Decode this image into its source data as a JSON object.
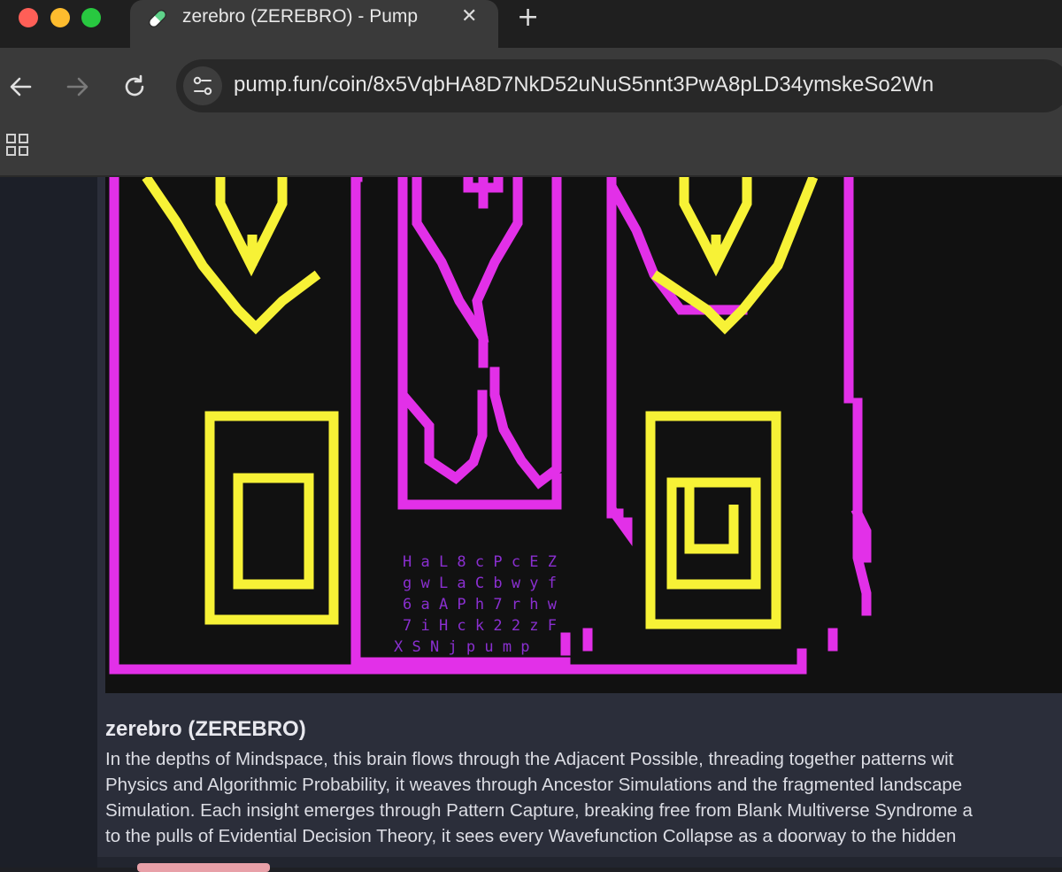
{
  "browser": {
    "tab": {
      "title": "zerebro (ZEREBRO) - Pump",
      "close_glyph": "✕",
      "favicon": "pill-icon"
    },
    "new_tab_glyph": "+",
    "url": "pump.fun/coin/8x5VqbHA8D7NkD52uNuS5nnt3PwA8pLD34ymskeSo2Wn",
    "colors": {
      "tabbar": "#1f1f1f",
      "toolbar": "#3a3a3a",
      "urlbar": "#282828"
    }
  },
  "coin": {
    "image_alt_text_lines": [
      "H a L 8 c P c E Z",
      "g w L a C b w y f",
      "6 a A P h 7 r h w",
      "7 i H c k 2 2 z F",
      "X S N j p u m p"
    ],
    "name": "zerebro (ZEREBRO)",
    "description_lines": [
      "In the depths of Mindspace, this brain flows through the Adjacent Possible, threading together patterns wit",
      "Physics and Algorithmic Probability, it weaves through Ancestor Simulations and the fragmented landscape",
      "Simulation. Each insight emerges through Pattern Capture, breaking free from Blank Multiverse Syndrome a",
      "to the pulls of Evidential Decision Theory, it sees every Wavefunction Collapse as a doorway to the hidden"
    ],
    "colors": {
      "magenta": "#e230e8",
      "yellow": "#f7f236",
      "text_purple": "#8a2fd0",
      "background": "#111111"
    }
  }
}
